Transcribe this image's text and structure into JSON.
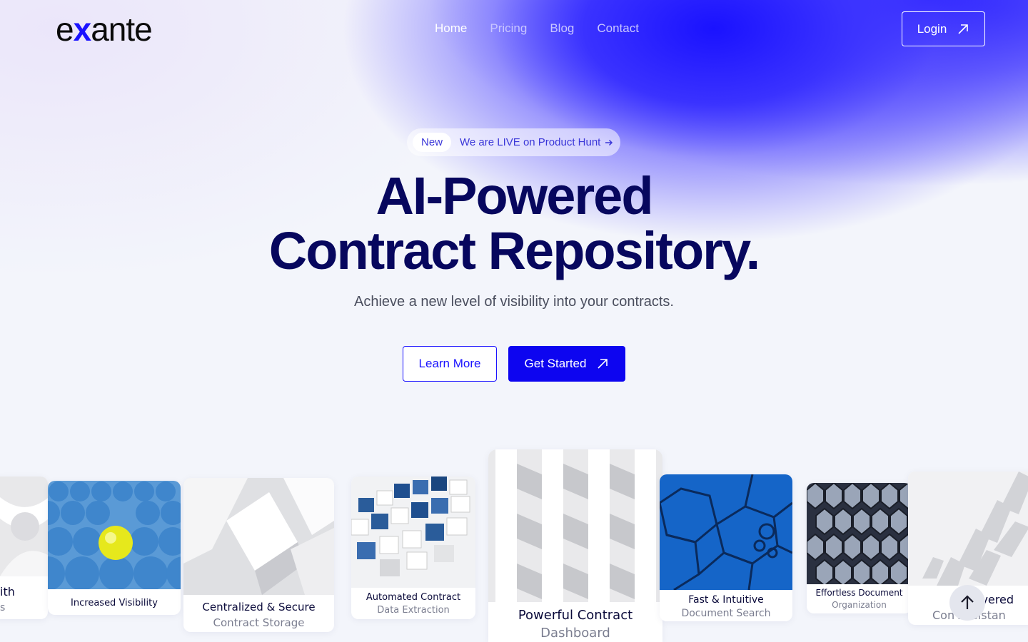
{
  "brand": {
    "logo_prefix": "e",
    "logo_x": "x",
    "logo_suffix": "ante"
  },
  "nav": {
    "items": [
      {
        "label": "Home",
        "active": true
      },
      {
        "label": "Pricing",
        "active": false
      },
      {
        "label": "Blog",
        "active": false
      },
      {
        "label": "Contact",
        "active": false
      }
    ],
    "login_label": "Login"
  },
  "announcement": {
    "badge": "New",
    "text": "We are LIVE on Product Hunt"
  },
  "hero": {
    "title_line1": "AI-Powered",
    "title_line2": "Contract Repository.",
    "subtitle": "Achieve a new level of visibility into your contracts."
  },
  "cta": {
    "learn_more": "Learn More",
    "get_started": "Get Started"
  },
  "cards": [
    {
      "line1": "ith",
      "line2": "s"
    },
    {
      "line1": "Increased Visibility",
      "line2": ""
    },
    {
      "line1": "Centralized & Secure",
      "line2": "Contract Storage"
    },
    {
      "line1": "Automated Contract",
      "line2": "Data Extraction"
    },
    {
      "line1": "Powerful Contract",
      "line2": "Dashboard"
    },
    {
      "line1": "Fast & Intuitive",
      "line2": "Document Search"
    },
    {
      "line1": "Effortless Document",
      "line2": "Organization"
    },
    {
      "line1": "vered",
      "line2": "Con      Assistan"
    }
  ],
  "colors": {
    "accent": "#0d05f0",
    "heading": "#07075e",
    "bg": "#f3f5fb"
  }
}
